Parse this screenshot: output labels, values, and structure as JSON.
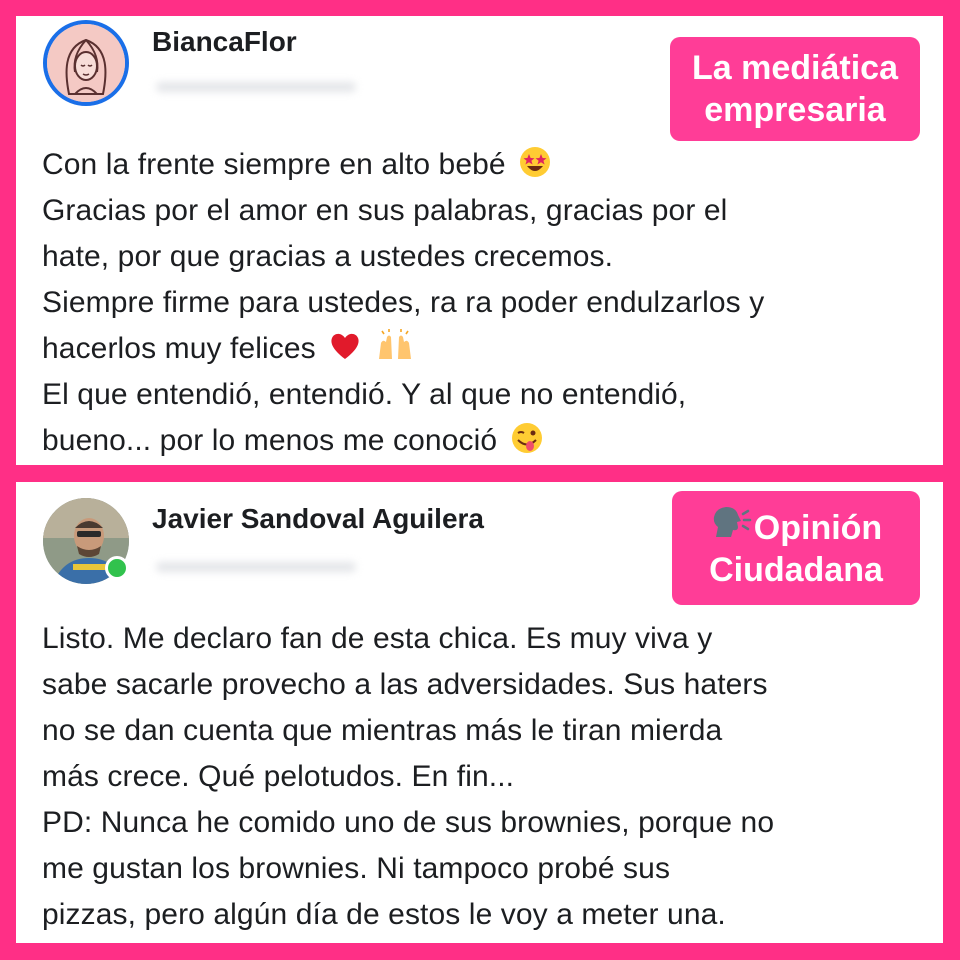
{
  "posts": [
    {
      "author": "BiancaFlor",
      "tag": {
        "lines": [
          "La mediática",
          "empresaria"
        ]
      },
      "lines": [
        "Con la frente siempre en alto bebé",
        "Gracias por el amor en sus palabras, gracias por el",
        "hate, por que gracias a ustedes crecemos.",
        "Siempre firme para ustedes, ra ra poder endulzarlos y",
        "hacerlos muy felices",
        "El que entendió, entendió. Y al que no entendió,",
        "bueno... por lo menos me conoció"
      ],
      "emojis": {
        "line0": "star-struck-emoji",
        "line4a": "red-heart-emoji",
        "line4b": "raising-hands-emoji",
        "line6": "winking-tongue-emoji"
      },
      "avatar_icon": "woman-portrait-icon"
    },
    {
      "author": "Javier Sandoval Aguilera",
      "tag": {
        "lines": [
          "Opinión",
          "Ciudadana"
        ],
        "icon": "speaking-head-icon"
      },
      "lines": [
        "Listo. Me declaro fan de esta chica. Es muy viva y",
        "sabe sacarle provecho a las adversidades. Sus haters",
        "no se dan cuenta que mientras más le tiran mierda",
        "más crece. Qué pelotudos. En fin...",
        "PD: Nunca he comido uno de sus brownies, porque no",
        "me gustan los brownies. Ni tampoco probé sus",
        "pizzas, pero algún día de estos le voy a meter una."
      ],
      "avatar_icon": "man-photo-avatar",
      "online": true
    }
  ],
  "colors": {
    "frame": "#ff2f86",
    "tag_bg": "#ff3d97",
    "avatar_ring": "#1a6fe8",
    "online": "#31c24d"
  }
}
